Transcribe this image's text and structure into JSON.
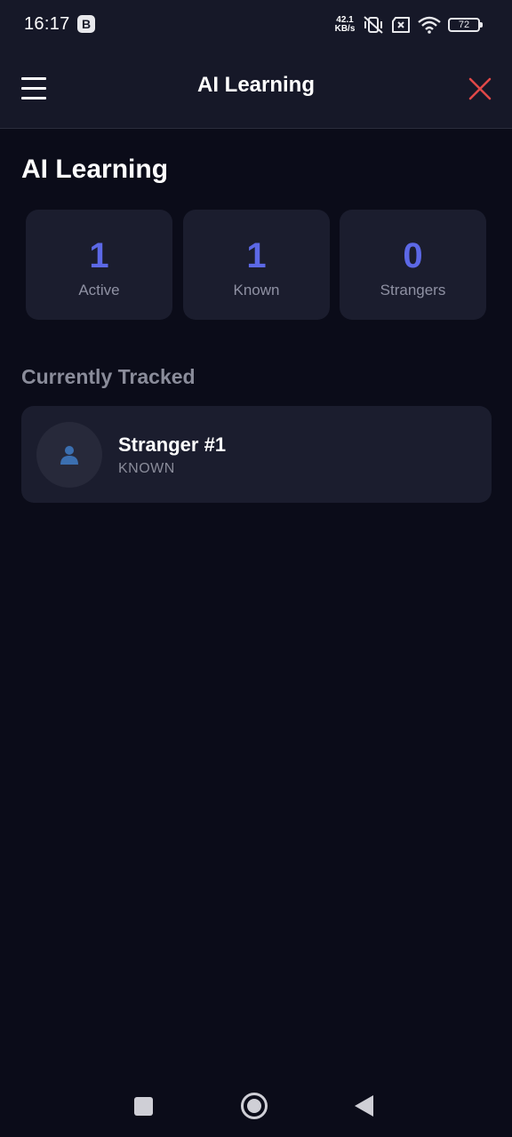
{
  "status_bar": {
    "time": "16:17",
    "app_badge": "B",
    "net_speed_value": "42.1",
    "net_speed_unit": "KB/s",
    "battery": "72",
    "icons": [
      "vibrate-off-icon",
      "sim-error-icon",
      "wifi-icon",
      "battery-icon"
    ]
  },
  "app_bar": {
    "title": "AI Learning",
    "menu_icon": "hamburger-menu-icon",
    "close_icon": "close-icon",
    "close_color": "#e04848"
  },
  "page": {
    "title": "AI Learning"
  },
  "stats": [
    {
      "value": "1",
      "label": "Active"
    },
    {
      "value": "1",
      "label": "Known"
    },
    {
      "value": "0",
      "label": "Strangers"
    }
  ],
  "tracked": {
    "section_title": "Currently Tracked",
    "items": [
      {
        "name": "Stranger #1",
        "status": "KNOWN",
        "icon": "person-icon"
      }
    ]
  },
  "colors": {
    "accent": "#5c68e6",
    "background": "#0b0c19",
    "card": "#1b1d2e",
    "header": "#161828"
  },
  "nav_bar": {
    "icons": [
      "recents-square-icon",
      "home-circle-icon",
      "back-triangle-icon"
    ]
  }
}
